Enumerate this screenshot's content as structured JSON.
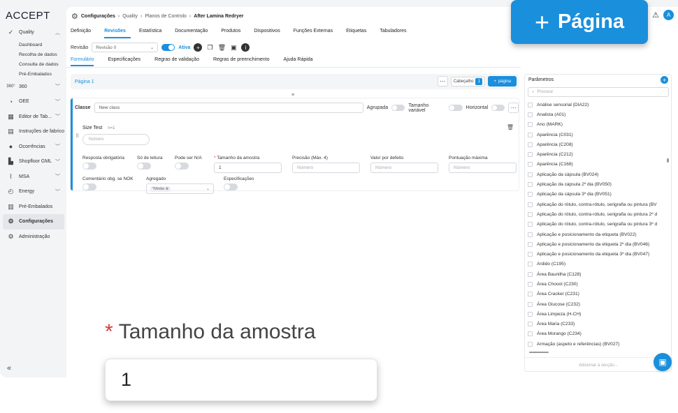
{
  "app": {
    "logo": "ACCEPT"
  },
  "sidebar": {
    "items": [
      {
        "label": "Quality",
        "icon": "check-circle-icon",
        "expandable": true
      },
      {
        "label": "360",
        "icon": "360-icon",
        "expandable": true
      },
      {
        "label": "OEE",
        "icon": "gauge-icon",
        "expandable": true
      },
      {
        "label": "Editor de Tab...",
        "icon": "table-icon",
        "expandable": true
      },
      {
        "label": "Instruções de fabrico",
        "icon": "book-icon",
        "expandable": false
      },
      {
        "label": "Ocorrências",
        "icon": "alert-icon",
        "expandable": true
      },
      {
        "label": "Shopfloor GML",
        "icon": "factory-icon",
        "expandable": true
      },
      {
        "label": "MSA",
        "icon": "chart-icon",
        "expandable": true
      },
      {
        "label": "Energy",
        "icon": "energy-icon",
        "expandable": true
      },
      {
        "label": "Pré-Embalados",
        "icon": "package-icon",
        "expandable": false
      },
      {
        "label": "Configurações",
        "icon": "gear-icon",
        "expandable": false
      },
      {
        "label": "Administração",
        "icon": "admin-icon",
        "expandable": false
      }
    ],
    "quality_sub": [
      "Dashboard",
      "Recolha de dados",
      "Consulta de dados",
      "Pré-Embalados"
    ],
    "collapse": "«"
  },
  "breadcrumb": [
    "Configurações",
    "Quality",
    "Planos de Controlo",
    "After Lamina Redryer"
  ],
  "header": {
    "avatar": "A"
  },
  "tabs": [
    "Definição",
    "Revisões",
    "Estatística",
    "Documentação",
    "Produtos",
    "Dispositivos",
    "Funções Externas",
    "Etiquetas",
    "Tabuladores"
  ],
  "active_tab": "Revisões",
  "revision": {
    "label": "Revisão",
    "value": "Revisão 0",
    "active_label": "Ativa"
  },
  "subtabs": [
    "Formulário",
    "Especificações",
    "Regras de validação",
    "Regras de preenchimento",
    "Ajuda Rápida"
  ],
  "active_subtab": "Formulário",
  "page": {
    "title": "Página 1",
    "header_label": "Cabeçalho",
    "header_count": "1",
    "add_page": "página"
  },
  "class_row": {
    "label": "Classe",
    "value": "New class",
    "agrupada": "Agrupada",
    "tamanho_variavel": "Tamanho variável",
    "horizontal": "Horizontal"
  },
  "field": {
    "name": "Size Test",
    "meta": "n=1",
    "number_placeholder": "Número",
    "resposta_obrigatoria": "Resposta obrigatória",
    "so_leitura": "Só de leitura",
    "pode_ser_na": "Pode ser N/A",
    "tamanho_amostra": "Tamanho da amostra",
    "tamanho_amostra_value": "1",
    "precisao": "Precisão (Máx. 4)",
    "precisao_ph": "Número",
    "valor_defeito": "Valor por defeito",
    "valor_defeito_ph": "Número",
    "pontuacao_maxima": "Pontuação máxima",
    "pontuacao_ph": "Número",
    "comentario_nok": "Comentário obg. se NOK",
    "agregado": "Agregado",
    "agregado_value": "*Média",
    "especificacoes": "Especificações"
  },
  "parameters": {
    "title": "Parâmetros",
    "search_placeholder": "Procurar",
    "items": [
      "Análise sensorial (DIA22)",
      "Analista (A01)",
      "Ano (MARK)",
      "Aparência (C031)",
      "Aparência (C208)",
      "Aparência (C212)",
      "Aparência (C168)",
      "Aplicação da cápsula (BV024)",
      "Aplicação da cápsula 2º dia (BV050)",
      "Aplicação da cápsula 3º dia (BV051)",
      "Aplicação do rótulo, contra-rótulo, serigrafia ou pintura (BV",
      "Aplicação do rótulo, contra-rótulo, serigrafia ou pintura 2º d",
      "Aplicação do rótulo, contra-rótulo, serigrafia ou pintura 3º d",
      "Aplicação e posicionamento da etiqueta (BV022)",
      "Aplicação e posicionamento da etiqueta 2º dia (BV046)",
      "Aplicação e posicionamento da etiqueta 3º dia (BV047)",
      "Ardido (C195)",
      "Área Baunilha (C128)",
      "Área Choool (C230)",
      "Área Cracker (C231)",
      "Área Glucose (C232)",
      "Área Limpeza (H-CH)",
      "Área Maria (C233)",
      "Área Morango (C234)",
      "Armação (aspeto e referências) (BV027)"
    ],
    "footer": "Adicionar à secção..."
  },
  "callouts": {
    "page_button": "Página",
    "zoom_label": "Tamanho da amostra",
    "zoom_value": "1"
  },
  "colors": {
    "accent": "#1a8fdc",
    "required": "#d63b3b"
  }
}
